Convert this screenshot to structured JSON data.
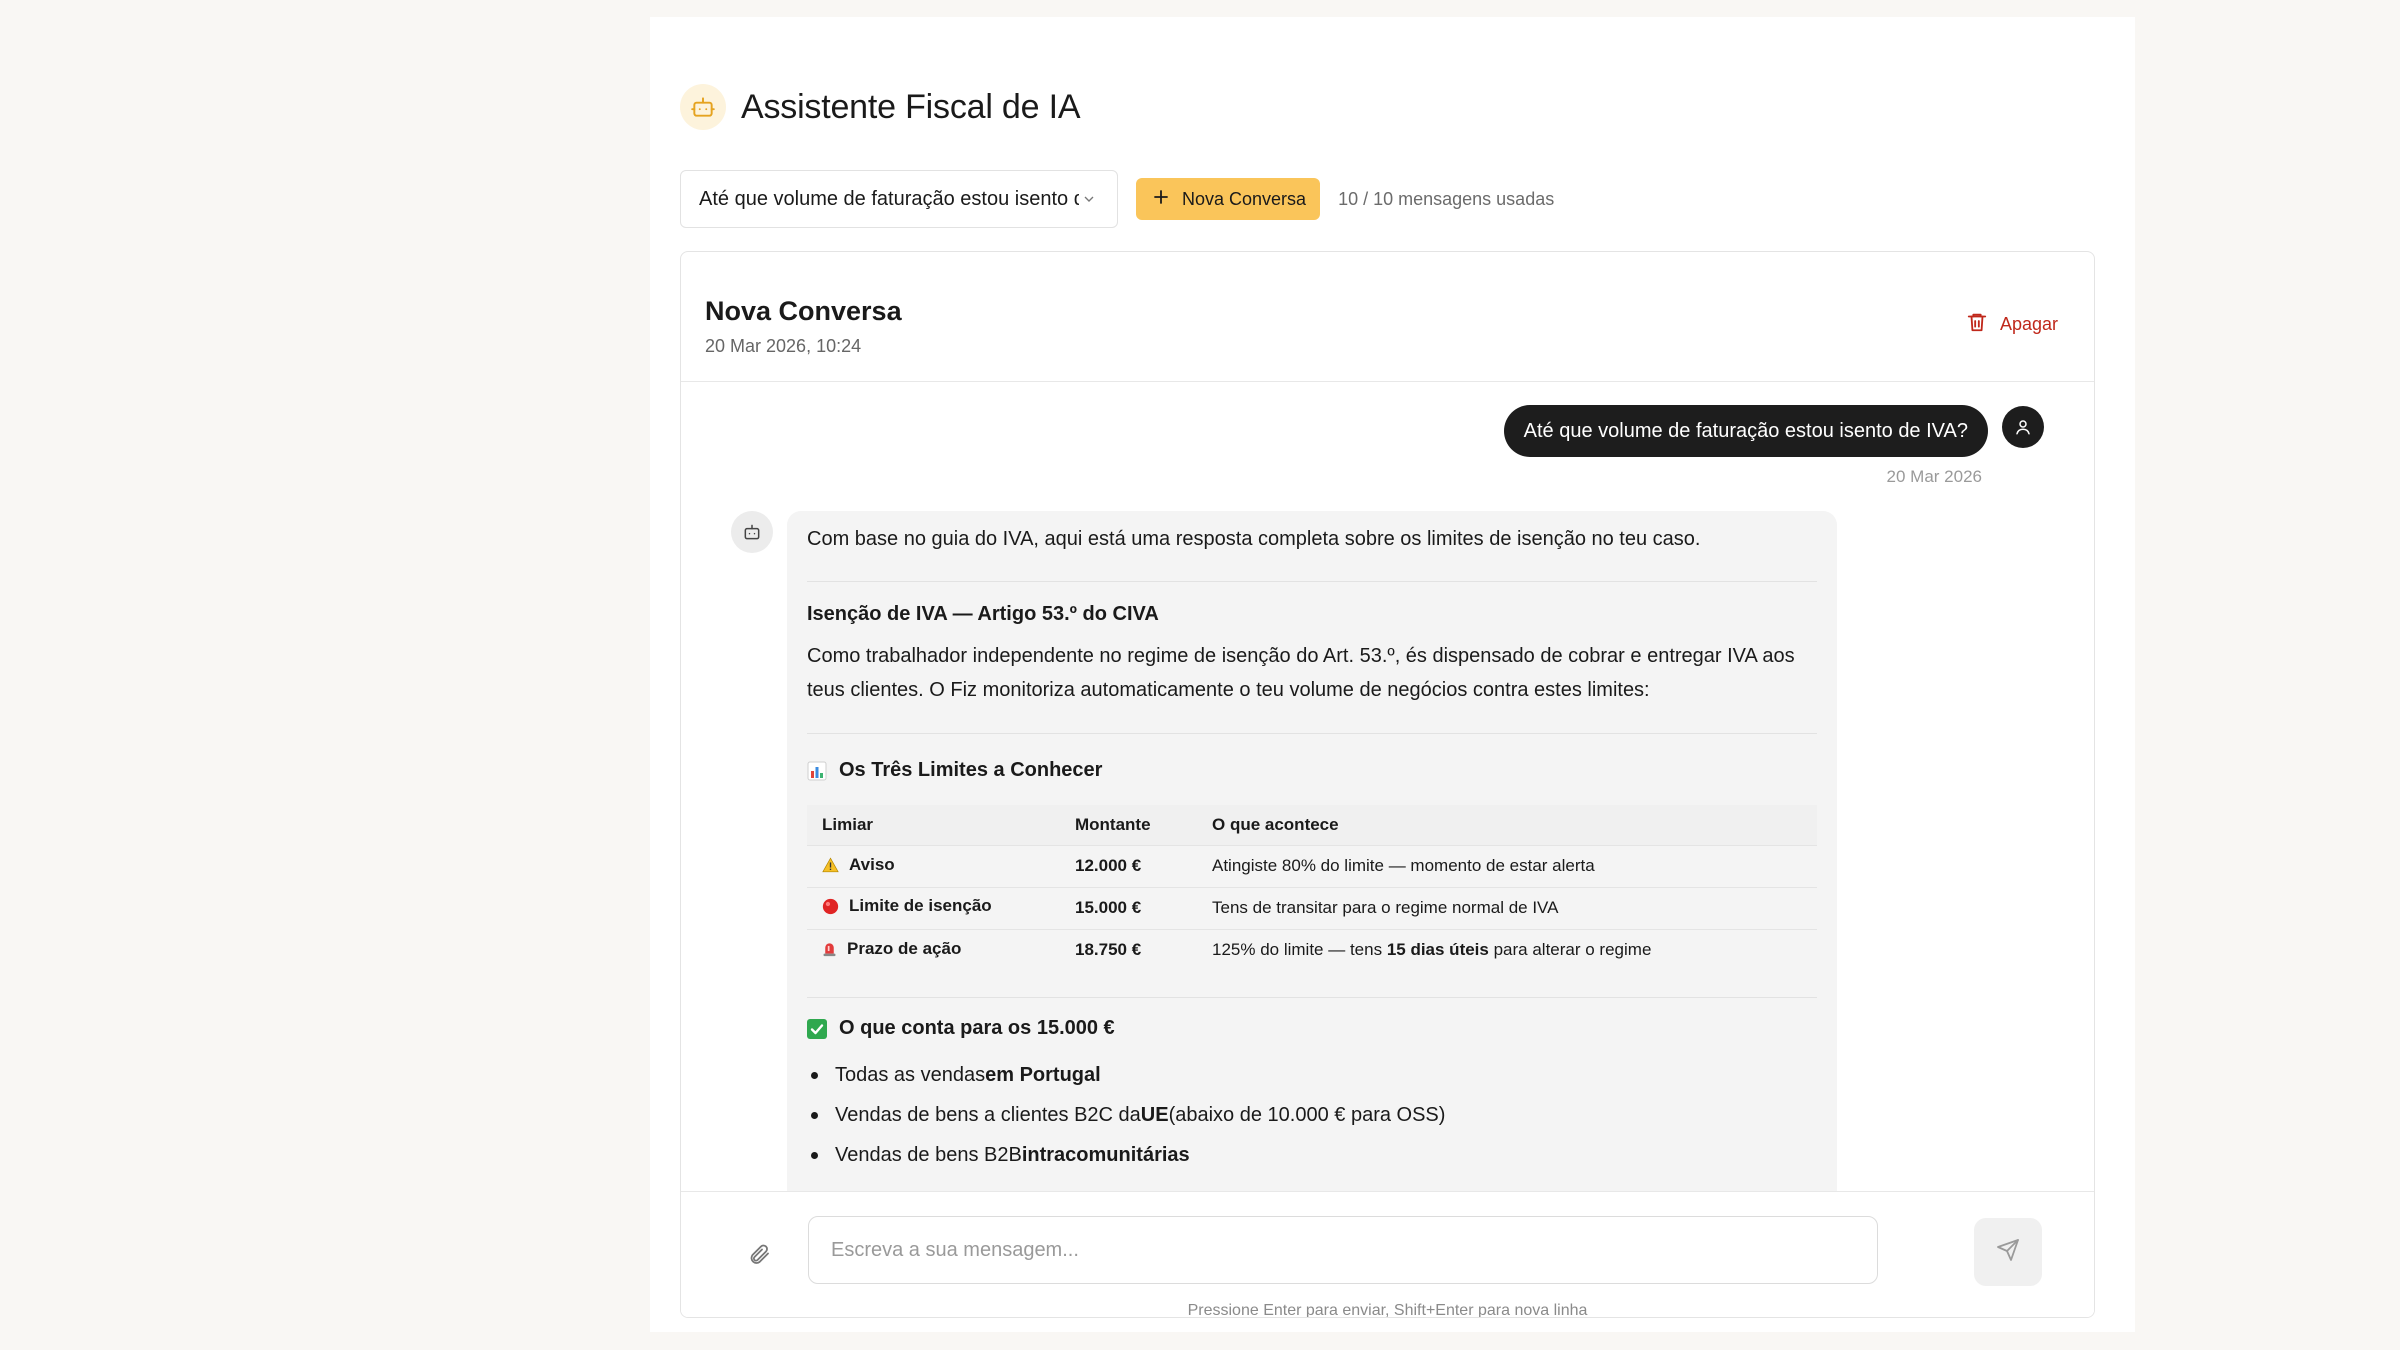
{
  "header": {
    "title": "Assistente Fiscal de IA",
    "icon": "robot-icon"
  },
  "toolbar": {
    "conversation_select_value": "Até que volume de faturação estou isento de IVA?",
    "new_button_label": "Nova Conversa",
    "usage_text": "10 / 10 mensagens usadas",
    "accent_color": "#fac55a"
  },
  "conversation": {
    "title": "Nova Conversa",
    "date": "20 Mar 2026, 10:24",
    "delete_label": "Apagar"
  },
  "messages": {
    "user": {
      "text": "Até que volume de faturação estou isento de IVA?",
      "time": "20 Mar 2026"
    },
    "assistant": {
      "intro": "Com base no guia do IVA, aqui está uma resposta completa sobre os limites de isenção no teu caso.",
      "heading": "Isenção de IVA — Artigo 53.º do CIVA",
      "paragraph": "Como trabalhador independente no regime de isenção do Art. 53.º, és dispensado de cobrar e entregar IVA aos teus clientes. O Fiz monitoriza automaticamente o teu volume de negócios contra estes limites:",
      "limits_heading": "Os Três Limites a Conhecer",
      "table": {
        "headers": [
          "Limiar",
          "Montante",
          "O que acontece"
        ],
        "rows": [
          {
            "icon": "warning-icon",
            "label": "Aviso",
            "amount": "12.000 €",
            "desc": "Atingiste 80% do limite — momento de estar alerta"
          },
          {
            "icon": "red-circle-icon",
            "label": "Limite de isenção",
            "amount": "15.000 €",
            "desc": "Tens de transitar para o regime normal de IVA"
          },
          {
            "icon": "siren-icon",
            "label": "Prazo de ação",
            "amount": "18.750 €",
            "desc_prefix": "125% do limite — tens ",
            "desc_bold": "15 dias úteis",
            "desc_suffix": " para alterar o regime"
          }
        ]
      },
      "counts_heading": "O que conta para os 15.000 €",
      "list": [
        {
          "prefix": "Todas as vendas ",
          "bold": "em Portugal",
          "suffix": ""
        },
        {
          "prefix": "Vendas de bens a clientes B2C da ",
          "bold": "UE",
          "suffix": " (abaixo de 10.000 € para OSS)"
        },
        {
          "prefix": "Vendas de bens B2B ",
          "bold": "intracomunitárias",
          "suffix": ""
        }
      ]
    }
  },
  "composer": {
    "placeholder": "Escreva a sua mensagem...",
    "hint": "Pressione Enter para enviar, Shift+Enter para nova linha"
  }
}
